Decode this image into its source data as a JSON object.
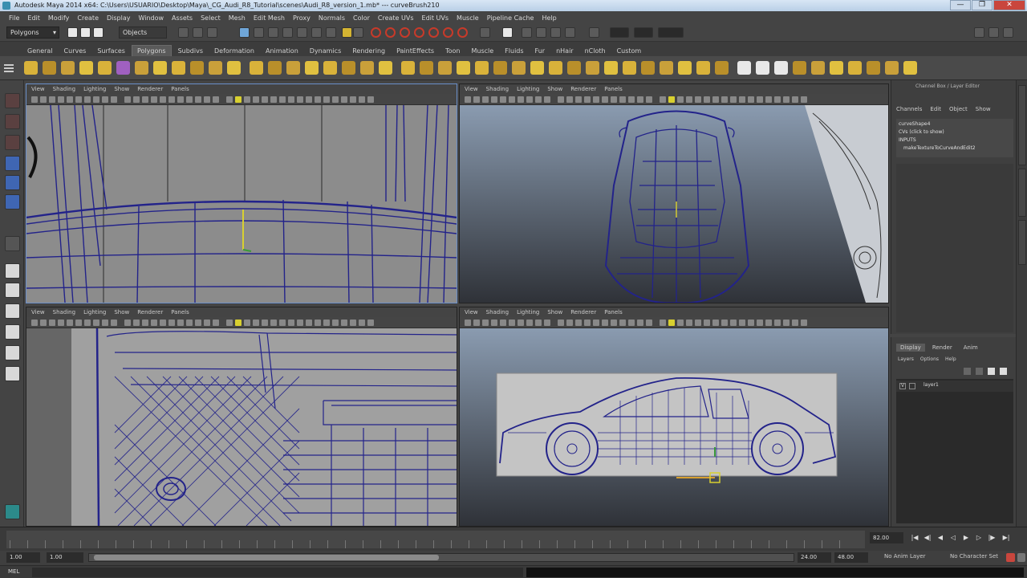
{
  "window": {
    "title": "Autodesk Maya 2014 x64: C:\\Users\\USUARIO\\Desktop\\Maya\\_CG_Audi_R8_Tutorial\\scenes\\Audi_R8_version_1.mb* --- curveBrush210",
    "minimize": "—",
    "maximize": "❐",
    "close": "✕"
  },
  "menubar": [
    "File",
    "Edit",
    "Modify",
    "Create",
    "Display",
    "Window",
    "Assets",
    "Select",
    "Mesh",
    "Edit Mesh",
    "Proxy",
    "Normals",
    "Color",
    "Create UVs",
    "Edit UVs",
    "Muscle",
    "Pipeline Cache",
    "Help"
  ],
  "statusline": {
    "mode": "Polygons",
    "objects_field": "Objects"
  },
  "shelf_tabs": [
    "General",
    "Curves",
    "Surfaces",
    "Polygons",
    "Subdivs",
    "Deformation",
    "Animation",
    "Dynamics",
    "Rendering",
    "PaintEffects",
    "Toon",
    "Muscle",
    "Fluids",
    "Fur",
    "nHair",
    "nCloth",
    "Custom"
  ],
  "shelf_active": "Polygons",
  "viewport_menu": [
    "View",
    "Shading",
    "Lighting",
    "Show",
    "Renderer",
    "Panels"
  ],
  "channel_box": {
    "title": "Channel Box / Layer Editor",
    "menu": [
      "Channels",
      "Edit",
      "Object",
      "Show"
    ],
    "lines": [
      "curveShape4",
      "CVs (click to show)",
      "INPUTS",
      "makeTextureToCurveAndEdit2"
    ]
  },
  "layer_editor": {
    "tabs": [
      "Display",
      "Render",
      "Anim"
    ],
    "active_tab": "Display",
    "menu": [
      "Layers",
      "Options",
      "Help"
    ],
    "layer": {
      "visible": "V",
      "name": "layer1"
    }
  },
  "timeslider": {
    "current_frame": "82.00"
  },
  "rangeslider": {
    "start": "1.00",
    "start_inner": "1.00",
    "end_inner": "24.00",
    "end": "48.00",
    "anim_layer": "No Anim Layer",
    "char_set": "No Character Set"
  },
  "cmdline": {
    "label": "MEL"
  },
  "colors": {
    "wire": "#23238a",
    "background": "#444444",
    "accent": "#6a8fc9"
  }
}
